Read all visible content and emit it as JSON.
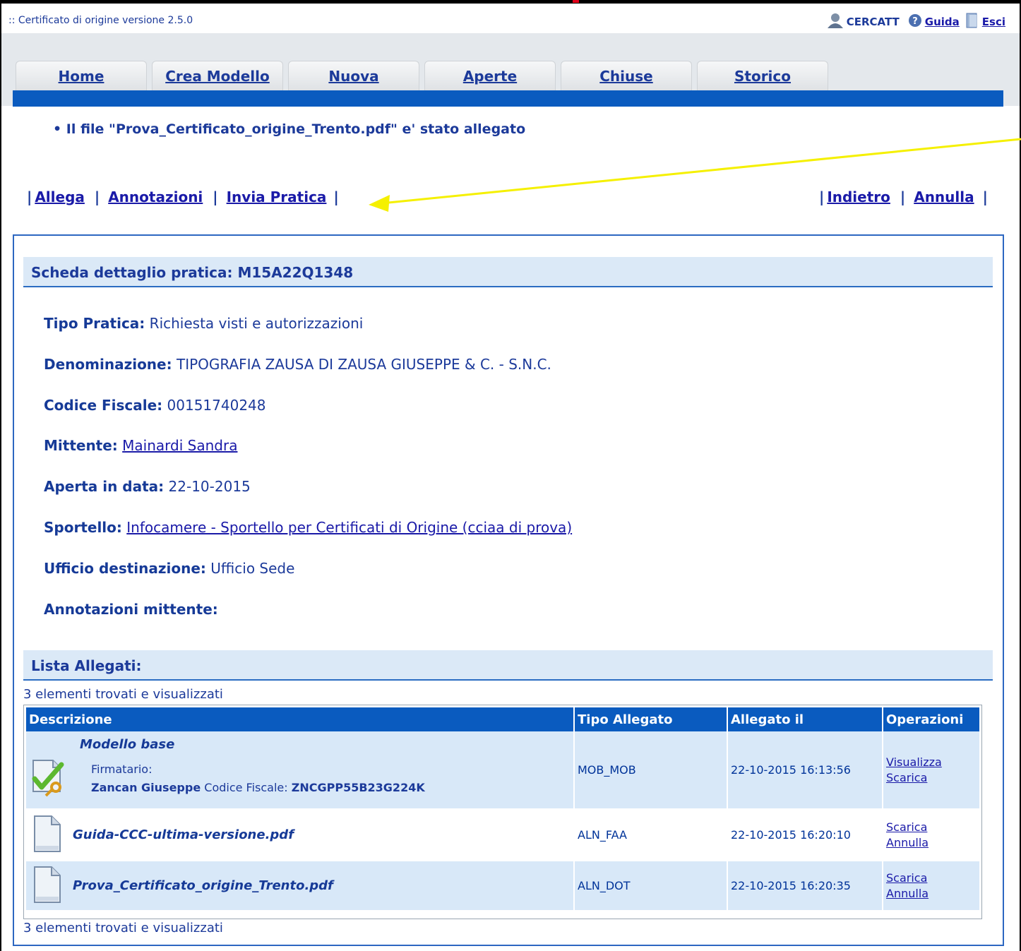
{
  "app": {
    "title": ":: Certificato di origine versione 2.5.0",
    "user": "CERCATT",
    "guide_label": "Guida",
    "exit_label": "Esci"
  },
  "nav": {
    "tabs": [
      "Home",
      "Crea Modello",
      "Nuova",
      "Aperte",
      "Chiuse",
      "Storico"
    ]
  },
  "message": "• Il file \"Prova_Certificato_origine_Trento.pdf\" e' stato allegato",
  "actions": {
    "left": [
      "Allega",
      "Annotazioni",
      "Invia Pratica"
    ],
    "right": [
      "Indietro",
      "Annulla"
    ]
  },
  "detail": {
    "header": "Scheda dettaglio pratica: M15A22Q1348",
    "fields": [
      {
        "label": "Tipo Pratica:",
        "value": "Richiesta visti e autorizzazioni"
      },
      {
        "label": "Denominazione:",
        "value": "TIPOGRAFIA ZAUSA DI ZAUSA GIUSEPPE & C. - S.N.C."
      },
      {
        "label": "Codice Fiscale:",
        "value": "00151740248"
      },
      {
        "label": "Mittente:",
        "value": "Mainardi Sandra"
      },
      {
        "label": "Aperta in data:",
        "value": "22-10-2015"
      },
      {
        "label": "Sportello:",
        "value": "Infocamere - Sportello per Certificati di Origine (cciaa di prova)"
      },
      {
        "label": "Ufficio destinazione:",
        "value": "Ufficio Sede"
      },
      {
        "label": "Annotazioni mittente:",
        "value": ""
      }
    ]
  },
  "attachments": {
    "header": "Lista Allegati:",
    "count_text": "3 elementi trovati e visualizzati",
    "columns": [
      "Descrizione",
      "Tipo Allegato",
      "Allegato il",
      "Operazioni"
    ],
    "rows": [
      {
        "description": "Modello base",
        "signer_label": "Firmatario:",
        "signer_name": "Zancan Giuseppe",
        "cf_label": "Codice Fiscale:",
        "cf_value": "ZNCGPP55B23G224K",
        "type": "MOB_MOB",
        "date": "22-10-2015 16:13:56",
        "ops": [
          "Visualizza",
          "Scarica"
        ],
        "icon": "signed-document-icon"
      },
      {
        "description": "Guida-CCC-ultima-versione.pdf",
        "type": "ALN_FAA",
        "date": "22-10-2015 16:20:10",
        "ops": [
          "Scarica",
          "Annulla"
        ],
        "icon": "document-icon"
      },
      {
        "description": "Prova_Certificato_origine_Trento.pdf",
        "type": "ALN_DOT",
        "date": "22-10-2015 16:20:35",
        "ops": [
          "Scarica",
          "Annulla"
        ],
        "icon": "document-icon"
      }
    ]
  },
  "colors": {
    "accent_blue": "#0a5bbf",
    "section_bg": "#dbe9f7",
    "annotation_arrow": "#f5f000"
  }
}
